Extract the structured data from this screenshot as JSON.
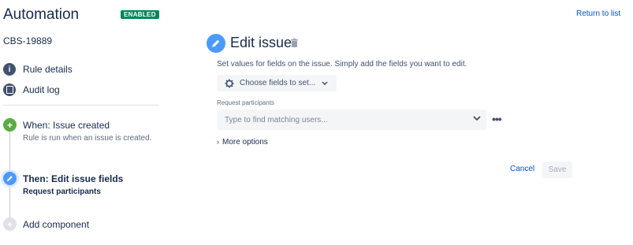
{
  "header": {
    "title": "Automation",
    "status_badge": "ENABLED",
    "return_link": "Return to list"
  },
  "rule": {
    "key": "CBS-19889"
  },
  "sidebar": {
    "items": [
      {
        "label": "Rule details",
        "icon": "info-icon"
      },
      {
        "label": "Audit log",
        "icon": "log-icon"
      }
    ]
  },
  "components": {
    "trigger": {
      "title": "When: Issue created",
      "subtitle": "Rule is run when an issue is created.",
      "icon": "plus-icon",
      "color": "#5aac44"
    },
    "action": {
      "title": "Then: Edit issue fields",
      "subtitle": "Request participants",
      "icon": "pencil-icon",
      "color": "#4c9aff"
    },
    "add": {
      "label": "Add component",
      "icon": "plus-icon"
    }
  },
  "panel": {
    "title": "Edit issue",
    "description": "Set values for fields on the issue. Simply add the fields you want to edit.",
    "choose_fields_label": "Choose fields to set...",
    "field_label": "Request participants",
    "field_placeholder": "Type to find matching users...",
    "more_options_label": "More options",
    "cancel_label": "Cancel",
    "save_label": "Save"
  },
  "colors": {
    "accent": "#0052cc",
    "badge": "#00875a",
    "edit_icon": "#4c9aff"
  }
}
